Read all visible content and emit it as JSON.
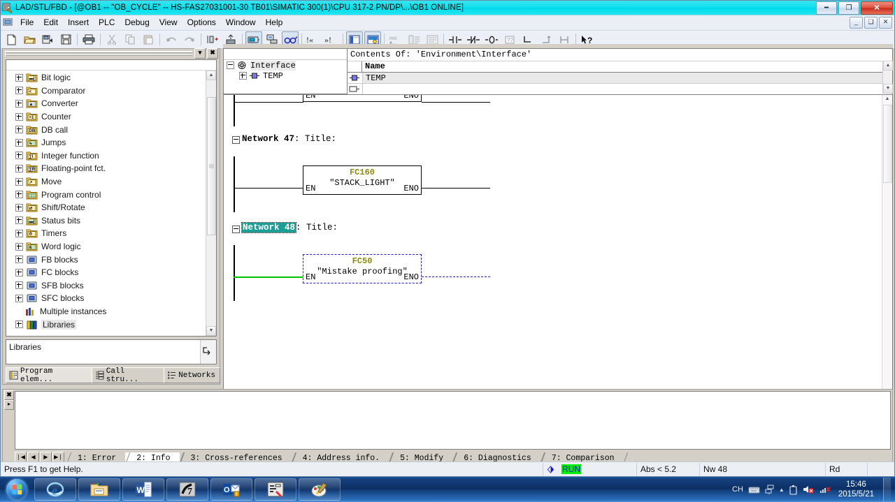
{
  "window": {
    "title": "LAD/STL/FBD  - [@OB1 -- \"OB_CYCLE\" -- HS-FAS27031001-30 TB01\\SIMATIC 300(1)\\CPU 317-2 PN/DP\\...\\OB1  ONLINE]",
    "minimize_label": "–",
    "restore_label": "❐",
    "close_label": "✕",
    "accent_title_bg": "#0fd9e8"
  },
  "mdi": {
    "minimize_label": "–",
    "restore_label": "❐",
    "close_label": "✕"
  },
  "menu": {
    "items": [
      {
        "label": "File"
      },
      {
        "label": "Edit"
      },
      {
        "label": "Insert"
      },
      {
        "label": "PLC"
      },
      {
        "label": "Debug"
      },
      {
        "label": "View"
      },
      {
        "label": "Options"
      },
      {
        "label": "Window"
      },
      {
        "label": "Help"
      }
    ]
  },
  "toolbar": {
    "buttons": [
      {
        "name": "new-icon",
        "glyph": "὜B",
        "state": "enabled"
      },
      {
        "name": "open-icon",
        "glyph": "open",
        "state": "enabled"
      },
      {
        "name": "save-as-icon",
        "glyph": "saveas",
        "state": "enabled"
      },
      {
        "name": "save-icon",
        "glyph": "save",
        "state": "enabled"
      },
      {
        "name": "print-icon",
        "glyph": "print",
        "state": "enabled"
      },
      {
        "name": "cut-icon",
        "glyph": "cut",
        "state": "disabled"
      },
      {
        "name": "copy-icon",
        "glyph": "copy",
        "state": "disabled"
      },
      {
        "name": "paste-icon",
        "glyph": "paste",
        "state": "disabled"
      },
      {
        "name": "undo-icon",
        "glyph": "undo",
        "state": "disabled"
      },
      {
        "name": "redo-icon",
        "glyph": "redo",
        "state": "disabled"
      },
      {
        "name": "download-icon",
        "glyph": "dl",
        "state": "enabled"
      },
      {
        "name": "upload-icon",
        "glyph": "ul",
        "state": "enabled"
      },
      {
        "name": "monitor-icon",
        "glyph": "mon",
        "state": "pressed"
      },
      {
        "name": "monitor-modify-icon",
        "glyph": "monmod",
        "state": "enabled"
      },
      {
        "name": "glasses-icon",
        "glyph": "glasses",
        "state": "pressed"
      },
      {
        "name": "goto-prev-error-icon",
        "glyph": "!≪",
        "state": "enabled"
      },
      {
        "name": "goto-next-error-icon",
        "glyph": "≫!",
        "state": "enabled"
      },
      {
        "name": "overview-icon",
        "glyph": "ov",
        "state": "pressed"
      },
      {
        "name": "symbol-table-icon",
        "glyph": "sym",
        "state": "pressed"
      },
      {
        "name": "symbol-info-icon",
        "glyph": "syminfo",
        "state": "disabled"
      },
      {
        "name": "symbol-select-icon",
        "glyph": "symsel",
        "state": "disabled"
      },
      {
        "name": "network-icon",
        "glyph": "net",
        "state": "disabled"
      },
      {
        "name": "no-contact-icon",
        "glyph": "⊣⊢",
        "state": "enabled"
      },
      {
        "name": "nc-contact-icon",
        "glyph": "nc",
        "state": "enabled"
      },
      {
        "name": "coil-icon",
        "glyph": "coil",
        "state": "enabled"
      },
      {
        "name": "empty-box-icon",
        "glyph": "box",
        "state": "disabled"
      },
      {
        "name": "open-branch-icon",
        "glyph": "brop",
        "state": "enabled"
      },
      {
        "name": "close-branch-icon",
        "glyph": "brcl",
        "state": "disabled"
      },
      {
        "name": "line-icon",
        "glyph": "line",
        "state": "disabled"
      },
      {
        "name": "help-pointer-icon",
        "glyph": "↖?",
        "state": "enabled"
      }
    ]
  },
  "left_panel": {
    "close_label": "✖",
    "dropdown_label": "▾",
    "tree": [
      {
        "label": "Bit logic",
        "icon": "folder-bitlogic-icon",
        "expandable": true
      },
      {
        "label": "Comparator",
        "icon": "folder-comparator-icon",
        "expandable": true
      },
      {
        "label": "Converter",
        "icon": "folder-converter-icon",
        "expandable": true
      },
      {
        "label": "Counter",
        "icon": "folder-counter-icon",
        "expandable": true
      },
      {
        "label": "DB call",
        "icon": "folder-dbcall-icon",
        "expandable": true
      },
      {
        "label": "Jumps",
        "icon": "folder-jumps-icon",
        "expandable": true
      },
      {
        "label": "Integer function",
        "icon": "folder-integer-icon",
        "expandable": true
      },
      {
        "label": "Floating-point fct.",
        "icon": "folder-float-icon",
        "expandable": true
      },
      {
        "label": "Move",
        "icon": "folder-move-icon",
        "expandable": true
      },
      {
        "label": "Program control",
        "icon": "folder-progctrl-icon",
        "expandable": true
      },
      {
        "label": "Shift/Rotate",
        "icon": "folder-shift-icon",
        "expandable": true
      },
      {
        "label": "Status bits",
        "icon": "folder-statusbits-icon",
        "expandable": true
      },
      {
        "label": "Timers",
        "icon": "folder-timers-icon",
        "expandable": true
      },
      {
        "label": "Word logic",
        "icon": "folder-wordlogic-icon",
        "expandable": true
      },
      {
        "label": "FB blocks",
        "icon": "folder-fb-icon",
        "expandable": true
      },
      {
        "label": "FC blocks",
        "icon": "folder-fc-icon",
        "expandable": true
      },
      {
        "label": "SFB blocks",
        "icon": "folder-sfb-icon",
        "expandable": true
      },
      {
        "label": "SFC blocks",
        "icon": "folder-sfc-icon",
        "expandable": true
      },
      {
        "label": "Multiple instances",
        "icon": "multi-instance-icon",
        "expandable": false
      },
      {
        "label": "Libraries",
        "icon": "libraries-icon",
        "expandable": true,
        "selected": true
      }
    ],
    "description": "Libraries",
    "tabs": [
      {
        "label": "Program elem...",
        "icon": "program-elements-icon",
        "active": true
      },
      {
        "label": "Call stru...",
        "icon": "call-structure-icon",
        "active": false
      },
      {
        "label": "Networks",
        "icon": "networks-icon",
        "active": false
      }
    ]
  },
  "interface_panel": {
    "tree": [
      {
        "label": "Interface",
        "icon": "interface-icon",
        "level": 0,
        "expandable": true,
        "expanded": true
      },
      {
        "label": "TEMP",
        "icon": "temp-var-icon",
        "level": 1,
        "expandable": true,
        "expanded": false
      }
    ],
    "contents_title": "Contents Of: 'Environment\\Interface'",
    "columns": [
      "Name"
    ],
    "rows": [
      {
        "icon": "temp-var-icon",
        "name": "TEMP"
      }
    ]
  },
  "ladder": {
    "networks": [
      {
        "header": null,
        "block": {
          "name": "",
          "symbol": "",
          "en": "EN",
          "eno": "ENO"
        },
        "truncated": true
      },
      {
        "header_prefix": "Network 47",
        "header_suffix": ": Title:",
        "selected": false,
        "block": {
          "name": "FC160",
          "symbol": "\"STACK_LIGHT\"",
          "en": "EN",
          "eno": "ENO",
          "name_color": "#8a8a10",
          "selected": false
        }
      },
      {
        "header_prefix": "Network 48",
        "header_suffix": ": Title:",
        "selected": true,
        "selection_color": "#1a9e96",
        "block": {
          "name": "FC50",
          "symbol": "\"Mistake proofing\"",
          "en": "EN",
          "eno": "ENO",
          "name_color": "#8a8a10",
          "selected": true,
          "power_rail_color": "#00c000"
        }
      }
    ]
  },
  "info_window": {
    "close_label": "✖",
    "expand_label": "▸",
    "nav": [
      "❘◀",
      "◀",
      "▶",
      "▶❘"
    ],
    "tabs": [
      {
        "label": "1: Error",
        "active": false
      },
      {
        "label": "2: Info",
        "active": true
      },
      {
        "label": "3: Cross-references",
        "active": false
      },
      {
        "label": "4: Address info.",
        "active": false
      },
      {
        "label": "5: Modify",
        "active": false
      },
      {
        "label": "6: Diagnostics",
        "active": false
      },
      {
        "label": "7: Comparison",
        "active": false
      }
    ],
    "content": ""
  },
  "status_bar": {
    "hint": "Press F1 to get Help.",
    "mode_icon": "plc-mode-icon",
    "mode": "RUN",
    "mode_bg": "#00ee00",
    "mode_fg": "#1515c8",
    "addressing": "Abs < 5.2",
    "network": "Nw 48",
    "access": "Rd",
    "extra1": "",
    "extra2": ""
  },
  "taskbar": {
    "start_label": "Start",
    "buttons": [
      {
        "name": "taskbar-internet-explorer",
        "icon": "ie-icon"
      },
      {
        "name": "taskbar-file-explorer",
        "icon": "explorer-icon"
      },
      {
        "name": "taskbar-word",
        "icon": "word-icon"
      },
      {
        "name": "taskbar-step7",
        "icon": "step7-icon"
      },
      {
        "name": "taskbar-outlook",
        "icon": "outlook-icon"
      },
      {
        "name": "taskbar-simatic-manager",
        "icon": "simatic-icon"
      },
      {
        "name": "taskbar-paint",
        "icon": "paint-icon"
      }
    ],
    "tray": {
      "language": "CH",
      "icons": [
        "keyboard-icon",
        "network-tray-icon",
        "show-hidden-icon",
        "battery-icon",
        "volume-muted-icon",
        "network-disconnected-icon"
      ],
      "time": "15:46",
      "date": "2015/5/21"
    }
  }
}
